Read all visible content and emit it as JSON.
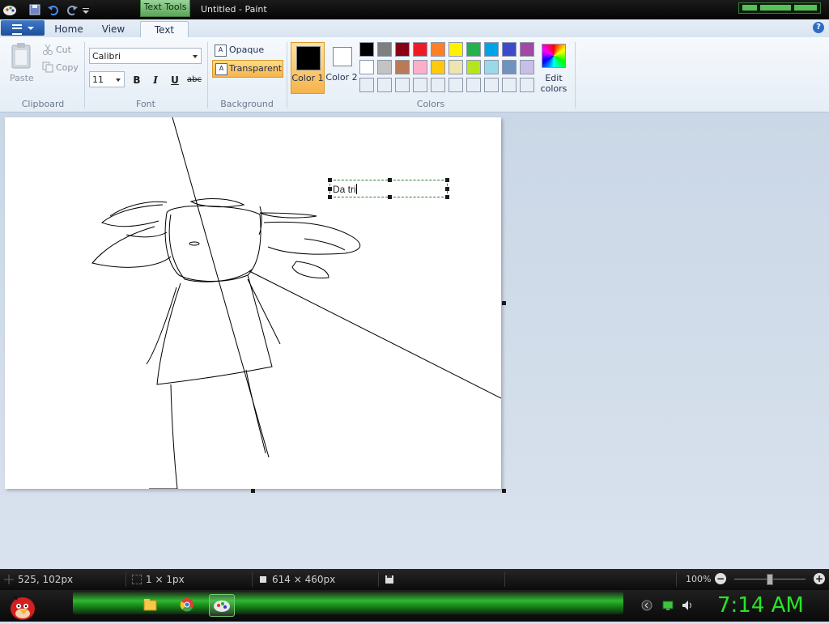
{
  "window": {
    "title": "Untitled - Paint",
    "contextual_tab": "Text Tools"
  },
  "tabs": [
    {
      "label": "Home",
      "active": false
    },
    {
      "label": "View",
      "active": false
    },
    {
      "label": "Text",
      "active": true
    }
  ],
  "ribbon": {
    "clipboard": {
      "label": "Clipboard",
      "paste": "Paste",
      "cut": "Cut",
      "copy": "Copy"
    },
    "font": {
      "label": "Font",
      "family": "Calibri",
      "size": "11",
      "bold": "B",
      "italic": "I",
      "underline": "U",
      "strikethrough": "abc"
    },
    "background": {
      "label": "Background",
      "opaque": "Opaque",
      "transparent": "Transparent",
      "selected": "Transparent"
    },
    "colors": {
      "label": "Colors",
      "color1": "Color 1",
      "color2": "Color 2",
      "edit_colors": "Edit colors",
      "color1_value": "#000000",
      "color2_value": "#ffffff",
      "palette_row1": [
        "#000000",
        "#7f7f7f",
        "#880015",
        "#ed1c24",
        "#ff7f27",
        "#fff200",
        "#22b14c",
        "#00a2e8",
        "#3f48cc",
        "#a349a4"
      ],
      "palette_row2": [
        "#ffffff",
        "#c3c3c3",
        "#b97a57",
        "#ffaec9",
        "#ffc90e",
        "#efe4b0",
        "#b5e61d",
        "#99d9ea",
        "#7092be",
        "#c8bfe7"
      ],
      "palette_row3": [
        "#e8eef6",
        "#e8eef6",
        "#e8eef6",
        "#e8eef6",
        "#e8eef6",
        "#e8eef6",
        "#e8eef6",
        "#e8eef6",
        "#e8eef6",
        "#e8eef6"
      ]
    }
  },
  "canvas": {
    "text_box_value": "Da tri"
  },
  "status": {
    "cursor_pos": "525, 102px",
    "selection_size": "1 × 1px",
    "image_size": "614 × 460px",
    "zoom": "100%"
  },
  "taskbar": {
    "clock": "7:14 AM"
  }
}
